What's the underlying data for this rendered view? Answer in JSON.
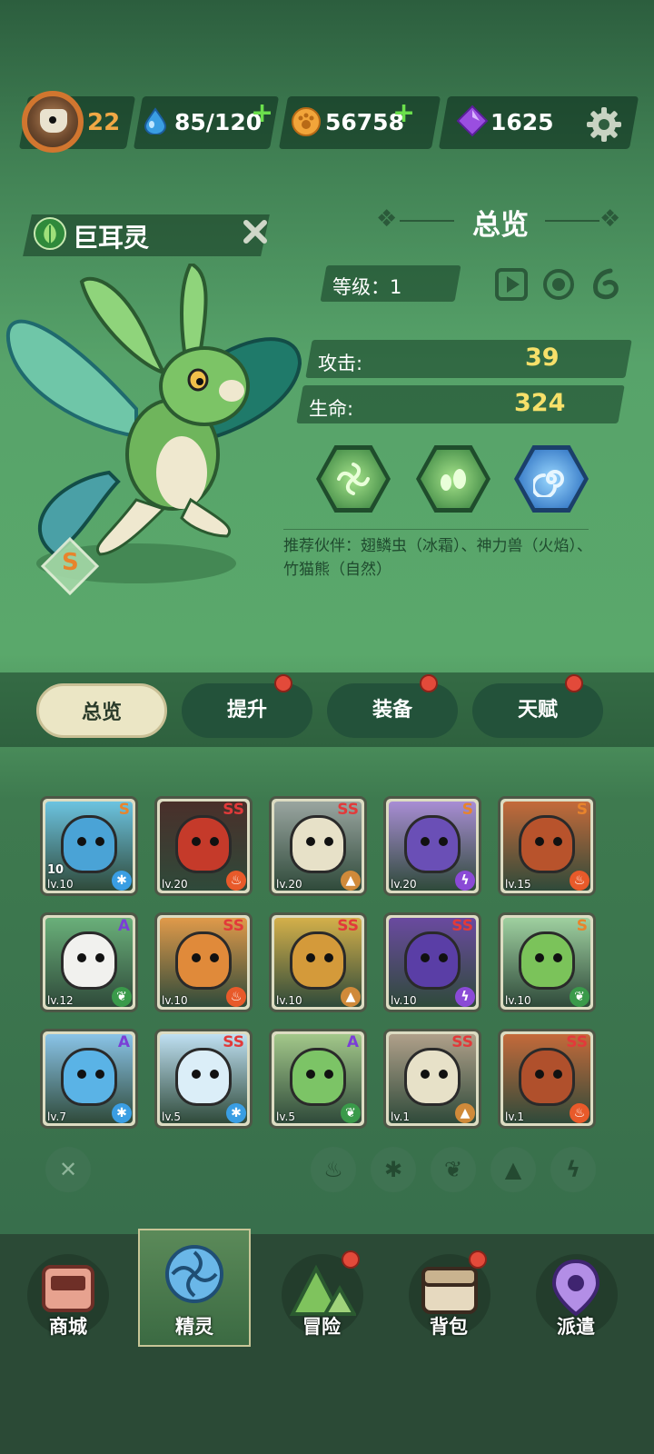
{
  "player": {
    "level": "22"
  },
  "resources": {
    "stamina": "85/120",
    "coins": "56758",
    "gems": "1625"
  },
  "icons": {
    "stamina": "water-drop-icon",
    "coins": "paw-coin-icon",
    "gems": "purple-gem-icon",
    "settings": "gear-icon"
  },
  "spirit": {
    "name": "巨耳灵",
    "rank": "S",
    "element": "leaf"
  },
  "overview": {
    "title": "总览",
    "level_label": "等级：1",
    "attack_label": "攻击:",
    "attack_value": "39",
    "hp_label": "生命:",
    "hp_value": "324",
    "recommend": "推荐伙伴：翅鳞虫（冰霜）、神力兽（火焰）、竹猫熊（自然）"
  },
  "tabs": [
    {
      "label": "总览",
      "active": true,
      "badge": false
    },
    {
      "label": "提升",
      "active": false,
      "badge": true
    },
    {
      "label": "装备",
      "active": false,
      "badge": true
    },
    {
      "label": "天赋",
      "active": false,
      "badge": true
    }
  ],
  "spirits": [
    {
      "rank": "S",
      "level": "lv.10",
      "element": "ice",
      "count": "10"
    },
    {
      "rank": "SS",
      "level": "lv.20",
      "element": "fire"
    },
    {
      "rank": "SS",
      "level": "lv.20",
      "element": "earth"
    },
    {
      "rank": "S",
      "level": "lv.20",
      "element": "thunder"
    },
    {
      "rank": "S",
      "level": "lv.15",
      "element": "fire"
    },
    {
      "rank": "A",
      "level": "lv.12",
      "element": "nature"
    },
    {
      "rank": "SS",
      "level": "lv.10",
      "element": "fire"
    },
    {
      "rank": "SS",
      "level": "lv.10",
      "element": "earth"
    },
    {
      "rank": "SS",
      "level": "lv.10",
      "element": "thunder"
    },
    {
      "rank": "S",
      "level": "lv.10",
      "element": "nature"
    },
    {
      "rank": "A",
      "level": "lv.7",
      "element": "ice"
    },
    {
      "rank": "SS",
      "level": "lv.5",
      "element": "ice"
    },
    {
      "rank": "A",
      "level": "lv.5",
      "element": "nature"
    },
    {
      "rank": "SS",
      "level": "lv.1",
      "element": "earth"
    },
    {
      "rank": "SS",
      "level": "lv.1",
      "element": "fire"
    }
  ],
  "filters": [
    "clear",
    "fire",
    "ice",
    "nature",
    "earth",
    "thunder"
  ],
  "nav": [
    {
      "label": "商城",
      "icon": "shop-icon",
      "badge": false
    },
    {
      "label": "精灵",
      "icon": "spirit-icon",
      "badge": false,
      "active": true
    },
    {
      "label": "冒险",
      "icon": "adventure-icon",
      "badge": true
    },
    {
      "label": "背包",
      "icon": "backpack-icon",
      "badge": true
    },
    {
      "label": "派遣",
      "icon": "dispatch-icon",
      "badge": false
    }
  ],
  "colors": {
    "rank_S": "#e8842c",
    "rank_SS": "#e23a3a",
    "rank_A": "#7a3fd6",
    "gold_value": "#f6e06a"
  }
}
